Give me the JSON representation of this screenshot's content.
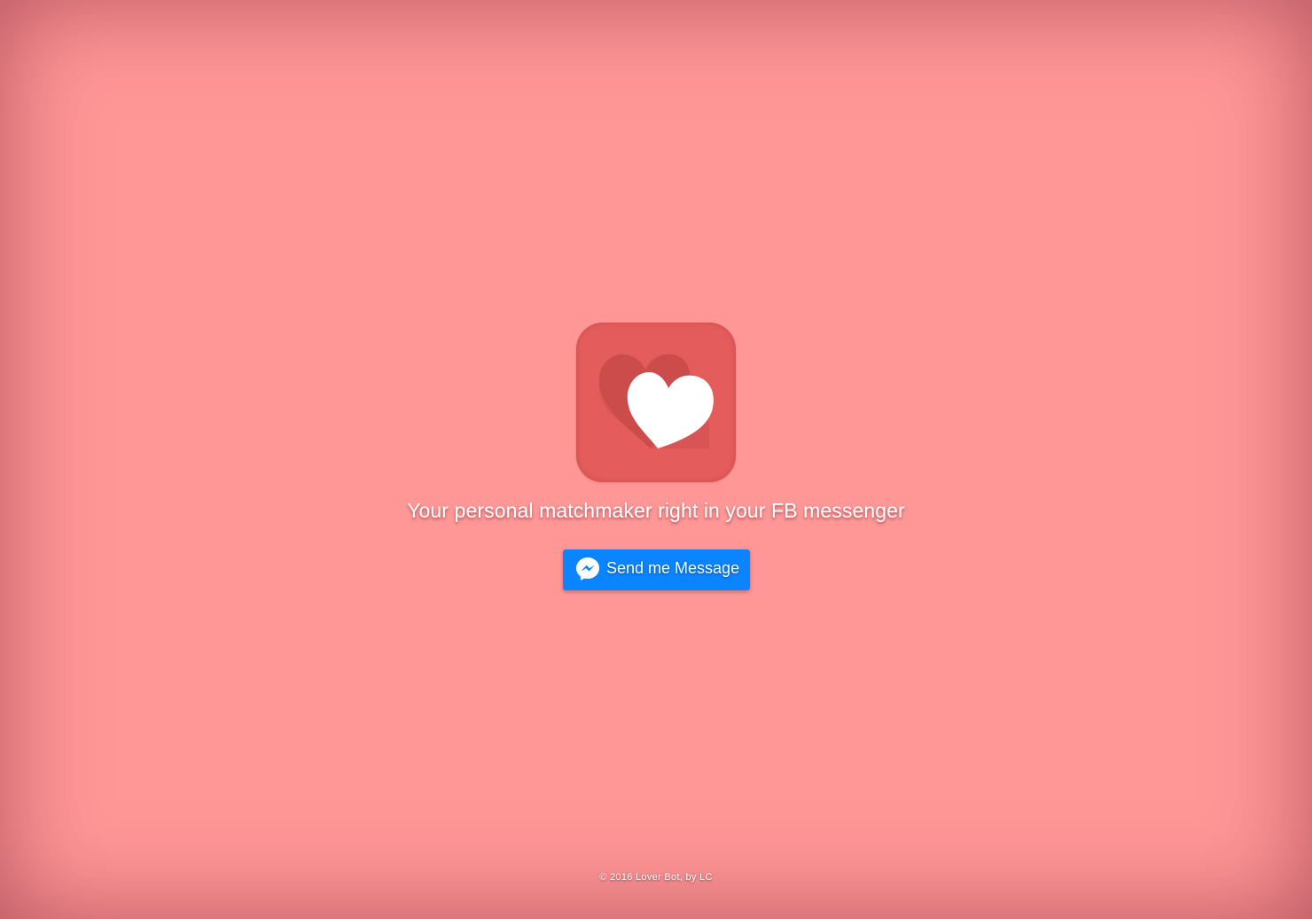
{
  "hero": {
    "logo_icon": "double-heart-icon",
    "tagline": "Your personal matchmaker right in your FB messenger"
  },
  "cta": {
    "icon": "messenger-icon",
    "label": "Send me Message"
  },
  "footer": {
    "text": "© 2016 Lover Bot, by LC"
  },
  "colors": {
    "background": "#ff9797",
    "icon_tile": "#e55c5c",
    "heart_back": "#d04d4d",
    "heart_front": "#ffffff",
    "button": "#0a84ff",
    "text": "#ffffff"
  }
}
